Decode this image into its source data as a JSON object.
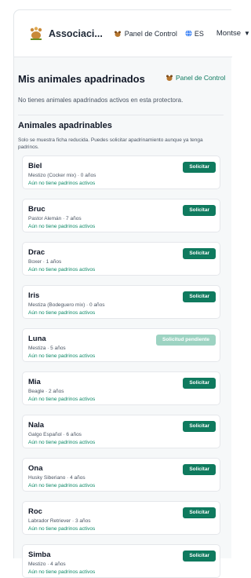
{
  "header": {
    "brand": "Associaci...",
    "panel_link": "Panel de Control",
    "language": "ES",
    "user": "Montse",
    "user_caret": "▼",
    "logo_icon": "paw-logo-icon",
    "panel_icon": "dog-icon",
    "globe_icon": "globe-icon"
  },
  "main": {
    "title": "Mis animales apadrinados",
    "panel_link": "Panel de Control",
    "empty_message": "No tienes animales apadrinados activos en esta protectora.",
    "section_title": "Animales apadrinables",
    "section_note": "Solo se muestra ficha reducida. Puedes solicitar apadrinamiento aunque ya tenga padrinos.",
    "animals": [
      {
        "name": "Biel",
        "meta": "Mestizo (Cocker mix) · 0 años",
        "status": "Aún no tiene padrinos activos",
        "button": "Solicitar",
        "pending": false
      },
      {
        "name": "Bruc",
        "meta": "Pastor Alemán · 7 años",
        "status": "Aún no tiene padrinos activos",
        "button": "Solicitar",
        "pending": false
      },
      {
        "name": "Drac",
        "meta": "Boxer · 1 años",
        "status": "Aún no tiene padrinos activos",
        "button": "Solicitar",
        "pending": false
      },
      {
        "name": "Iris",
        "meta": "Mestiza (Bodeguero mix) · 0 años",
        "status": "Aún no tiene padrinos activos",
        "button": "Solicitar",
        "pending": false
      },
      {
        "name": "Luna",
        "meta": "Mestiza · 5 años",
        "status": "Aún no tiene padrinos activos",
        "button": "Solicitud pendiente",
        "pending": true
      },
      {
        "name": "Mia",
        "meta": "Beagle · 2 años",
        "status": "Aún no tiene padrinos activos",
        "button": "Solicitar",
        "pending": false
      },
      {
        "name": "Nala",
        "meta": "Galgo Español · 6 años",
        "status": "Aún no tiene padrinos activos",
        "button": "Solicitar",
        "pending": false
      },
      {
        "name": "Ona",
        "meta": "Husky Siberiano · 4 años",
        "status": "Aún no tiene padrinos activos",
        "button": "Solicitar",
        "pending": false
      },
      {
        "name": "Roc",
        "meta": "Labrador Retriever · 3 años",
        "status": "Aún no tiene padrinos activos",
        "button": "Solicitar",
        "pending": false
      },
      {
        "name": "Simba",
        "meta": "Mestizo · 4 años",
        "status": "Aún no tiene padrinos activos",
        "button": "Solicitar",
        "pending": false
      }
    ]
  },
  "colors": {
    "accent": "#0f7a5e",
    "accent_pending": "#9dd3c2",
    "status_text": "#0f8a68",
    "background": "#f6f8f9"
  }
}
